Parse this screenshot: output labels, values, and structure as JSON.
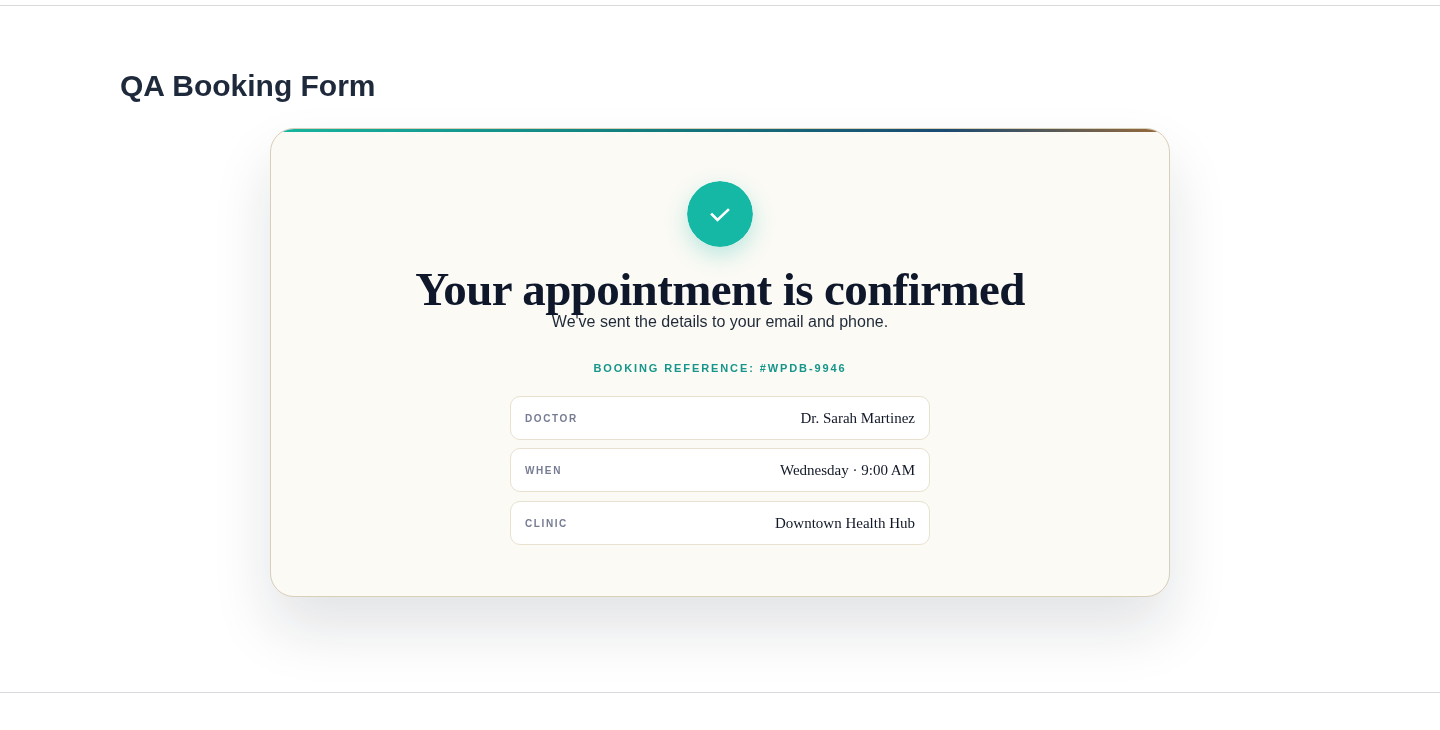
{
  "page_title": "QA Booking Form",
  "card": {
    "heading": "Your appointment is confirmed",
    "subtitle": "We've sent the details to your email and phone.",
    "reference": "BOOKING REFERENCE: #WPDB-9946",
    "details": [
      {
        "label": "DOCTOR",
        "value": "Dr. Sarah Martinez"
      },
      {
        "label": "WHEN",
        "value": "Wednesday · 9:00 AM"
      },
      {
        "label": "CLINIC",
        "value": "Downtown Health Hub"
      }
    ]
  }
}
